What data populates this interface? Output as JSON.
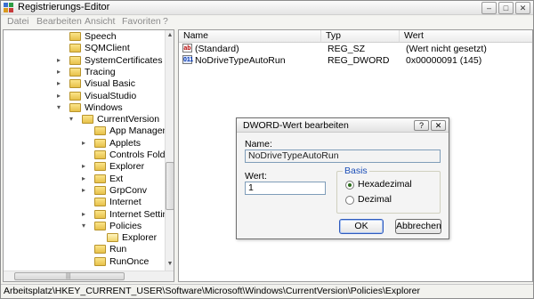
{
  "window": {
    "title": "Registrierungs-Editor"
  },
  "menu": [
    "Datei",
    "Bearbeiten",
    "Ansicht",
    "Favoriten",
    "?"
  ],
  "tree": {
    "items": [
      {
        "label": "Speech",
        "level": 3,
        "expander": ""
      },
      {
        "label": "SQMClient",
        "level": 3,
        "expander": ""
      },
      {
        "label": "SystemCertificates",
        "level": 3,
        "expander": "+"
      },
      {
        "label": "Tracing",
        "level": 3,
        "expander": "+"
      },
      {
        "label": "Visual Basic",
        "level": 3,
        "expander": "+"
      },
      {
        "label": "VisualStudio",
        "level": 3,
        "expander": "+"
      },
      {
        "label": "Windows",
        "level": 3,
        "expander": "-"
      },
      {
        "label": "CurrentVersion",
        "level": 4,
        "expander": "-"
      },
      {
        "label": "App Manageme",
        "level": 5,
        "expander": ""
      },
      {
        "label": "Applets",
        "level": 5,
        "expander": "+"
      },
      {
        "label": "Controls Folder",
        "level": 5,
        "expander": ""
      },
      {
        "label": "Explorer",
        "level": 5,
        "expander": "+"
      },
      {
        "label": "Ext",
        "level": 5,
        "expander": "+"
      },
      {
        "label": "GrpConv",
        "level": 5,
        "expander": "+"
      },
      {
        "label": "Internet",
        "level": 5,
        "expander": ""
      },
      {
        "label": "Internet Setting",
        "level": 5,
        "expander": "+"
      },
      {
        "label": "Policies",
        "level": 5,
        "expander": "-"
      },
      {
        "label": "Explorer",
        "level": 6,
        "expander": "",
        "open": true
      },
      {
        "label": "Run",
        "level": 5,
        "expander": ""
      },
      {
        "label": "RunOnce",
        "level": 5,
        "expander": ""
      }
    ]
  },
  "list": {
    "columns": [
      "Name",
      "Typ",
      "Wert"
    ],
    "rows": [
      {
        "icon": "ab",
        "name": "(Standard)",
        "type": "REG_SZ",
        "value": "(Wert nicht gesetzt)"
      },
      {
        "icon": "011",
        "name": "NoDriveTypeAutoRun",
        "type": "REG_DWORD",
        "value": "0x00000091 (145)"
      }
    ]
  },
  "status": {
    "path": "Arbeitsplatz\\HKEY_CURRENT_USER\\Software\\Microsoft\\Windows\\CurrentVersion\\Policies\\Explorer"
  },
  "dialog": {
    "title": "DWORD-Wert bearbeiten",
    "help": "?",
    "close": "✕",
    "name_label": "Name:",
    "name_value": "NoDriveTypeAutoRun",
    "value_label": "Wert:",
    "value_value": "1",
    "basis_label": "Basis",
    "radio_hex": "Hexadezimal",
    "radio_dec": "Dezimal",
    "selected_base": "Hexadezimal",
    "ok": "OK",
    "cancel": "Abbrechen"
  }
}
